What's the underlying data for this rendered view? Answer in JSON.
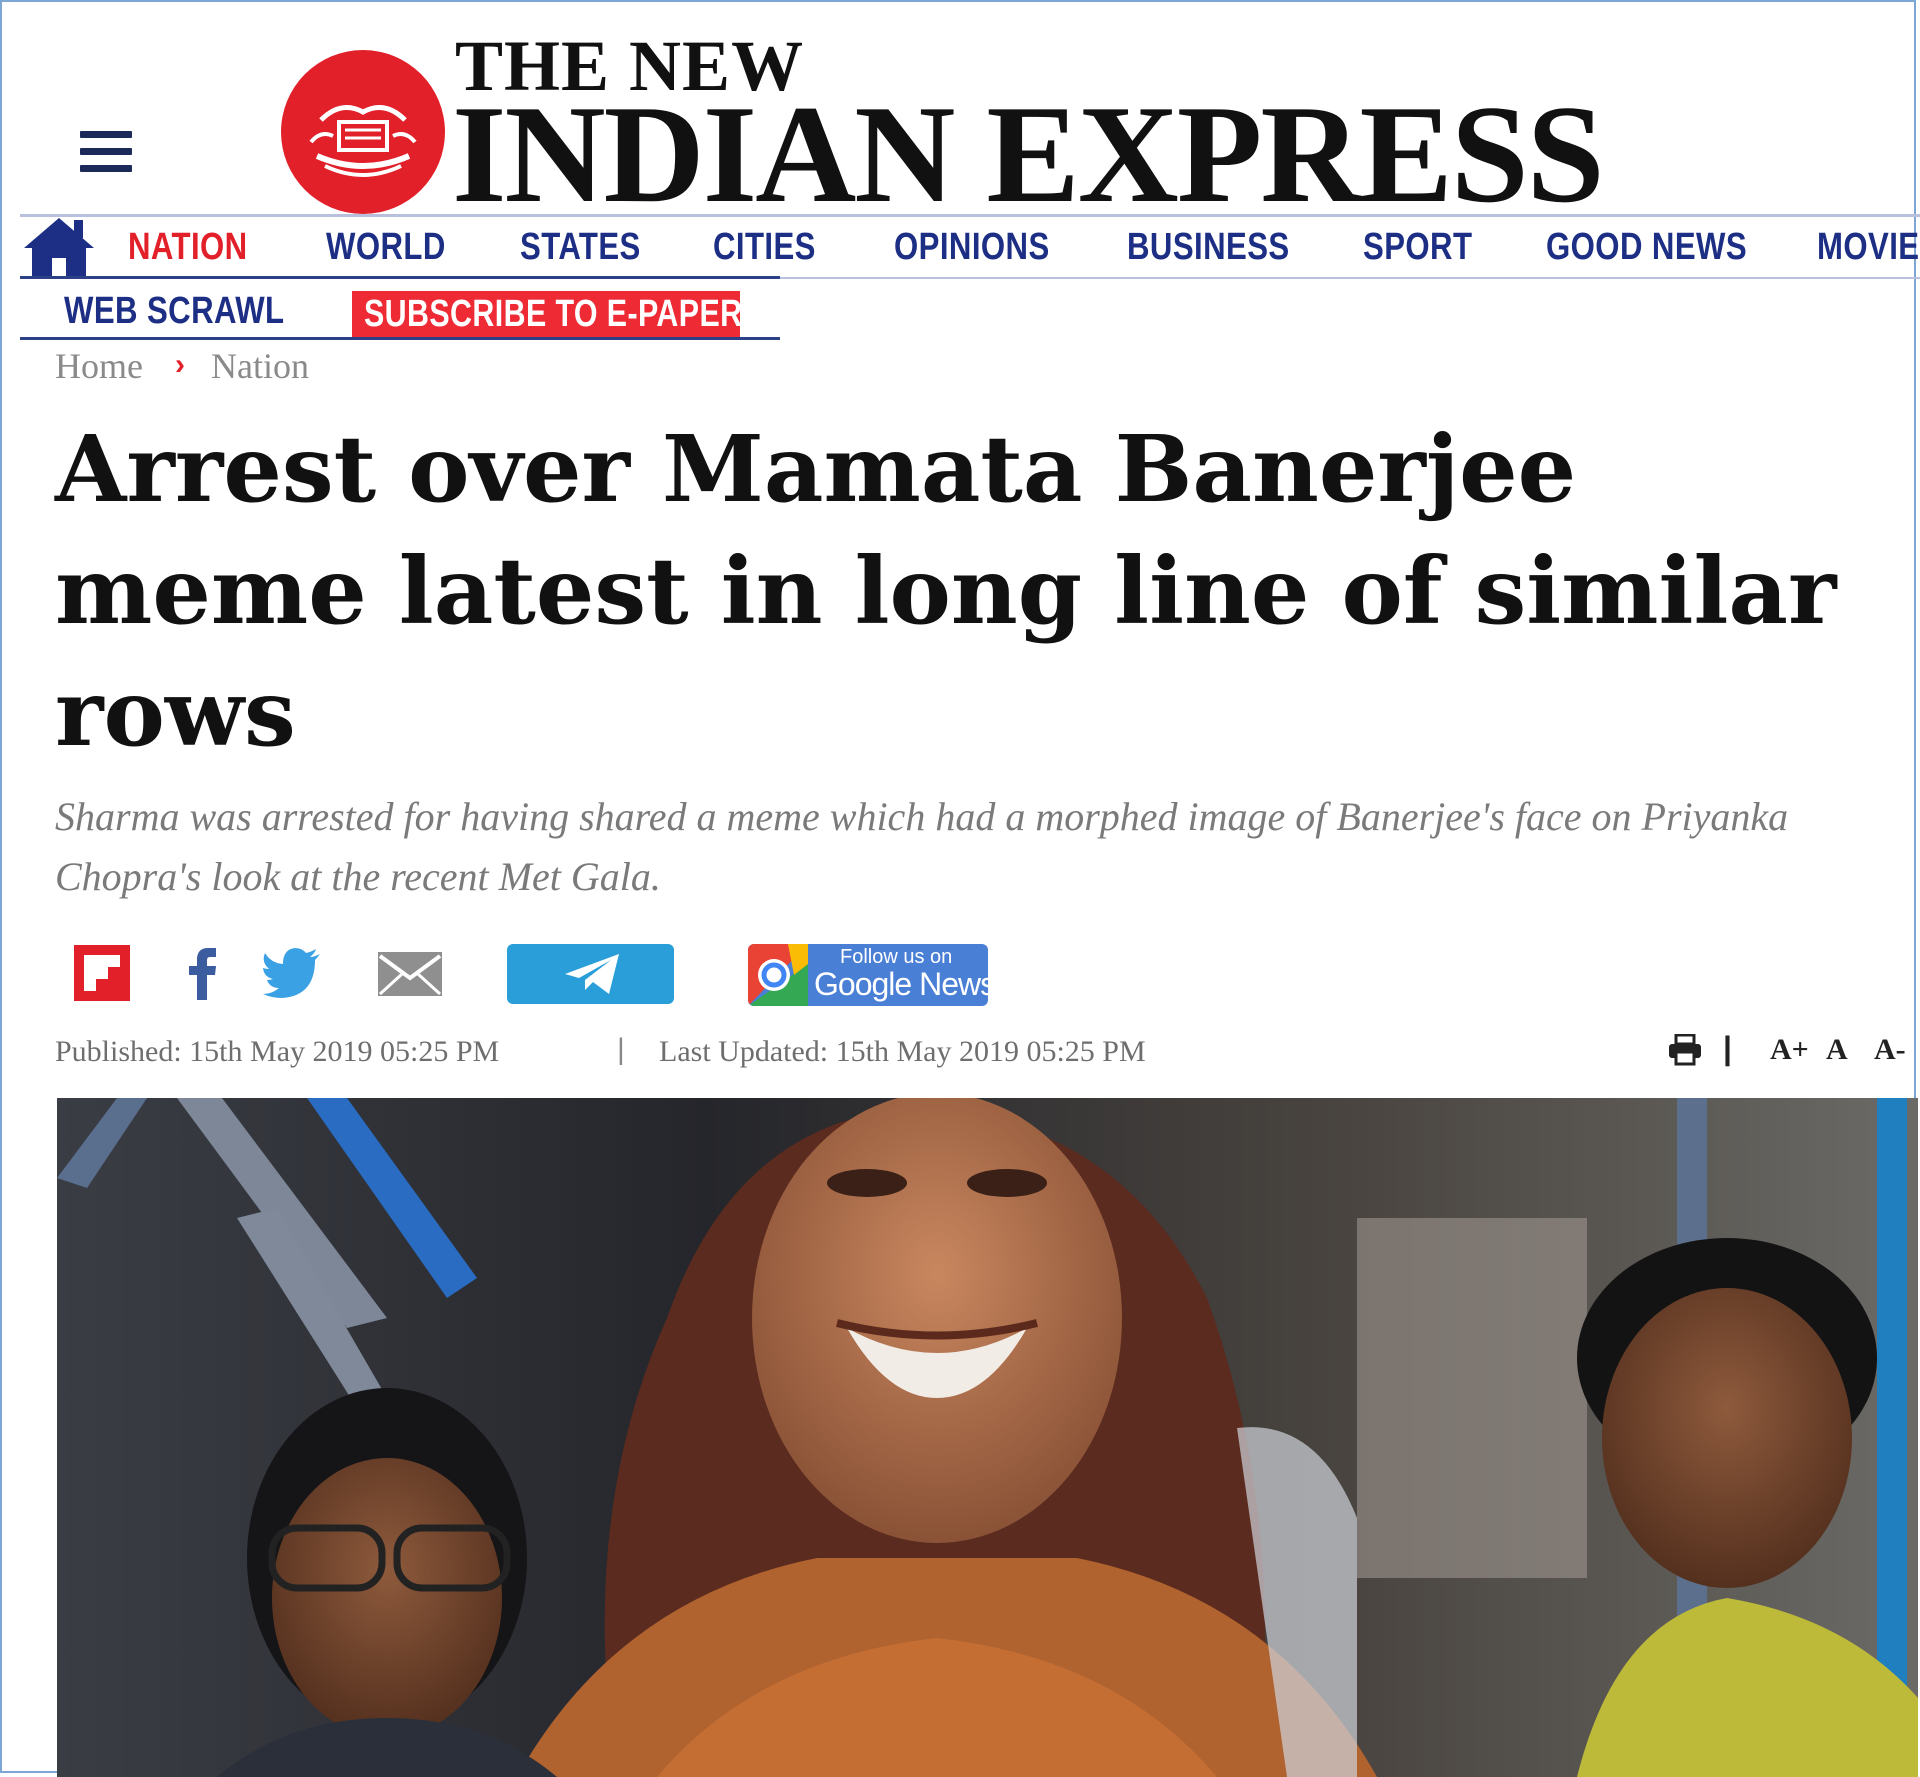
{
  "masthead": {
    "line1": "THE NEW",
    "line2": "INDIAN EXPRESS",
    "logo_icon": "newspaper-emblem",
    "menu_icon": "hamburger-menu-icon",
    "brand_color": "#e2202a"
  },
  "nav": {
    "home_icon": "home-icon",
    "items": [
      {
        "label": "NATION",
        "active": true
      },
      {
        "label": "WORLD"
      },
      {
        "label": "STATES"
      },
      {
        "label": "CITIES"
      },
      {
        "label": "OPINIONS"
      },
      {
        "label": "BUSINESS"
      },
      {
        "label": "SPORT"
      },
      {
        "label": "GOOD NEWS"
      },
      {
        "label": "MOVIE"
      }
    ],
    "row2": {
      "web_scrawl": "WEB SCRAWL",
      "subscribe": "SUBSCRIBE TO E-PAPER"
    },
    "nav_color": "#1d2f85",
    "active_color": "#e2202a"
  },
  "breadcrumb": {
    "home": "Home",
    "separator": "›",
    "section": "Nation"
  },
  "article": {
    "headline": "Arrest over Mamata Banerjee meme latest in long line of similar rows",
    "summary": "Sharma was arrested for having shared a meme which had a morphed image of Banerjee's face on Priyanka Chopra's look at the recent Met Gala.",
    "published": "Published: 15th May 2019 05:25 PM",
    "meta_separator": "|",
    "updated": "Last Updated: 15th May 2019 05:25 PM"
  },
  "share": {
    "icons": [
      "flipboard-icon",
      "facebook-icon",
      "twitter-icon",
      "email-icon",
      "telegram-icon",
      "google-news-icon"
    ],
    "google_news_small": "Follow us on",
    "google_news_big": "Google News"
  },
  "tools": {
    "print_icon": "print-icon",
    "separator": "|",
    "font_increase": "A+",
    "font_normal": "A",
    "font_decrease": "A-"
  }
}
